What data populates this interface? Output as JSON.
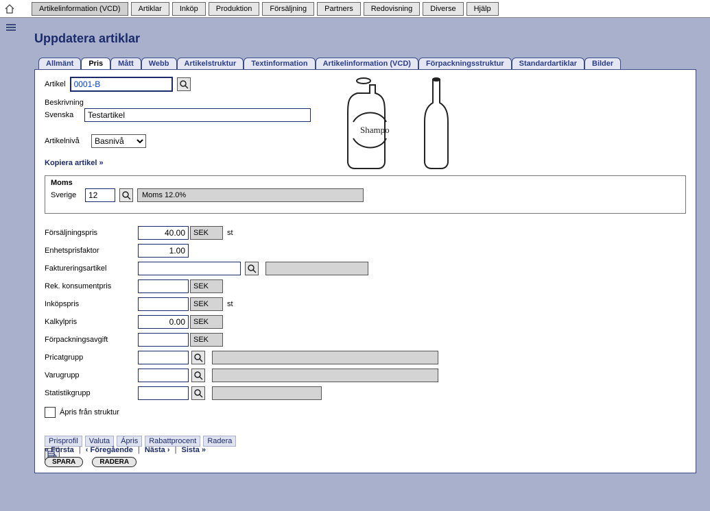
{
  "topmenu": {
    "items": [
      "Artikelinformation (VCD)",
      "Artiklar",
      "Inköp",
      "Produktion",
      "Försäljning",
      "Partners",
      "Redovisning",
      "Diverse",
      "Hjälp"
    ]
  },
  "page": {
    "title": "Uppdatera artiklar"
  },
  "tabs": {
    "items": [
      "Allmänt",
      "Pris",
      "Mått",
      "Webb",
      "Artikelstruktur",
      "Textinformation",
      "Artikelinformation (VCD)",
      "Förpackningsstruktur",
      "Standardartiklar",
      "Bilder"
    ],
    "active_index": 1
  },
  "form": {
    "artikel_label": "Artikel",
    "artikel_value": "0001-B",
    "beskrivning_label": "Beskrivning",
    "svenska_label": "Svenska",
    "beskrivning_value": "Testartikel",
    "artikelniva_label": "Artikelnivå",
    "artikelniva_value": "Basnivå",
    "kopiera_label": "Kopiera artikel »"
  },
  "moms": {
    "header": "Moms",
    "country_label": "Sverige",
    "code": "12",
    "display": "Moms 12.0%"
  },
  "prices": {
    "forsalj": {
      "label": "Försäljningspris",
      "value": "40.00",
      "currency": "SEK",
      "unit": "st"
    },
    "enhet": {
      "label": "Enhetsprisfaktor",
      "value": "1.00"
    },
    "fakt": {
      "label": "Faktureringsartikel",
      "value": "",
      "display": ""
    },
    "rek": {
      "label": "Rek. konsumentpris",
      "value": "",
      "currency": "SEK"
    },
    "inkop": {
      "label": "Inköpspris",
      "value": "",
      "currency": "SEK",
      "unit": "st"
    },
    "kalkyl": {
      "label": "Kalkylpris",
      "value": "0.00",
      "currency": "SEK"
    },
    "forpack": {
      "label": "Förpackningsavgift",
      "value": "",
      "currency": "SEK"
    },
    "pricat": {
      "label": "Pricatgrupp",
      "value": ""
    },
    "varu": {
      "label": "Varugrupp",
      "value": ""
    },
    "stat": {
      "label": "Statistikgrupp",
      "value": ""
    },
    "apris_chk": {
      "label": "Ápris från struktur",
      "checked": false
    }
  },
  "subtable": {
    "cols": [
      "Prisprofil",
      "Valuta",
      "Ápris",
      "Rabattprocent",
      "Radera"
    ]
  },
  "pager": {
    "first": "« Första",
    "prev": "‹ Föregående",
    "next": "Nästa ›",
    "last": "Sista »"
  },
  "actions": {
    "save": "SPARA",
    "delete": "RADERA"
  }
}
